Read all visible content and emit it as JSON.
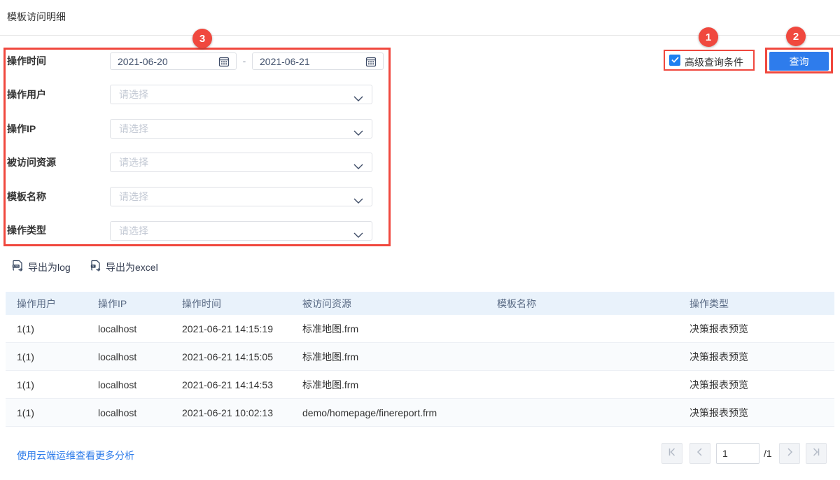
{
  "page": {
    "title": "模板访问明细"
  },
  "filter": {
    "time_label": "操作时间",
    "date_from": "2021-06-20",
    "date_to": "2021-06-21",
    "date_separator": "-",
    "rows": [
      {
        "label": "操作用户",
        "placeholder": "请选择"
      },
      {
        "label": "操作IP",
        "placeholder": "请选择"
      },
      {
        "label": "被访问资源",
        "placeholder": "请选择"
      },
      {
        "label": "模板名称",
        "placeholder": "请选择"
      },
      {
        "label": "操作类型",
        "placeholder": "请选择"
      }
    ],
    "advanced": {
      "label": "高级查询条件",
      "checked": true
    },
    "query_button": "查询"
  },
  "annotations": {
    "badge_1": "1",
    "badge_2": "2",
    "badge_3": "3"
  },
  "export": {
    "log": "导出为log",
    "excel": "导出为excel"
  },
  "table": {
    "headers": [
      "操作用户",
      "操作IP",
      "操作时间",
      "被访问资源",
      "模板名称",
      "操作类型"
    ],
    "rows": [
      [
        "1(1)",
        "localhost",
        "2021-06-21 14:15:19",
        "标准地图.frm",
        "",
        "决策报表预览"
      ],
      [
        "1(1)",
        "localhost",
        "2021-06-21 14:15:05",
        "标准地图.frm",
        "",
        "决策报表预览"
      ],
      [
        "1(1)",
        "localhost",
        "2021-06-21 14:14:53",
        "标准地图.frm",
        "",
        "决策报表预览"
      ],
      [
        "1(1)",
        "localhost",
        "2021-06-21 10:02:13",
        "demo/homepage/finereport.frm",
        "",
        "决策报表预览"
      ]
    ]
  },
  "footer": {
    "cloud_link": "使用云端运维查看更多分析",
    "pagination": {
      "current": "1",
      "total": "/1"
    }
  },
  "colors": {
    "annotation_red": "#f0483e",
    "button_blue": "#2e7cec",
    "checkbox_blue": "#1e80f0",
    "link_blue": "#2e7cea",
    "table_header_bg": "#e9f2fb"
  },
  "icons": {
    "date": "calendar-icon",
    "select": "chevron-down-icon",
    "export_log": "file-log-icon",
    "export_excel": "file-excel-icon",
    "checkbox": "check-icon",
    "pagination": [
      "first-page-icon",
      "prev-page-icon",
      "next-page-icon",
      "last-page-icon"
    ]
  }
}
